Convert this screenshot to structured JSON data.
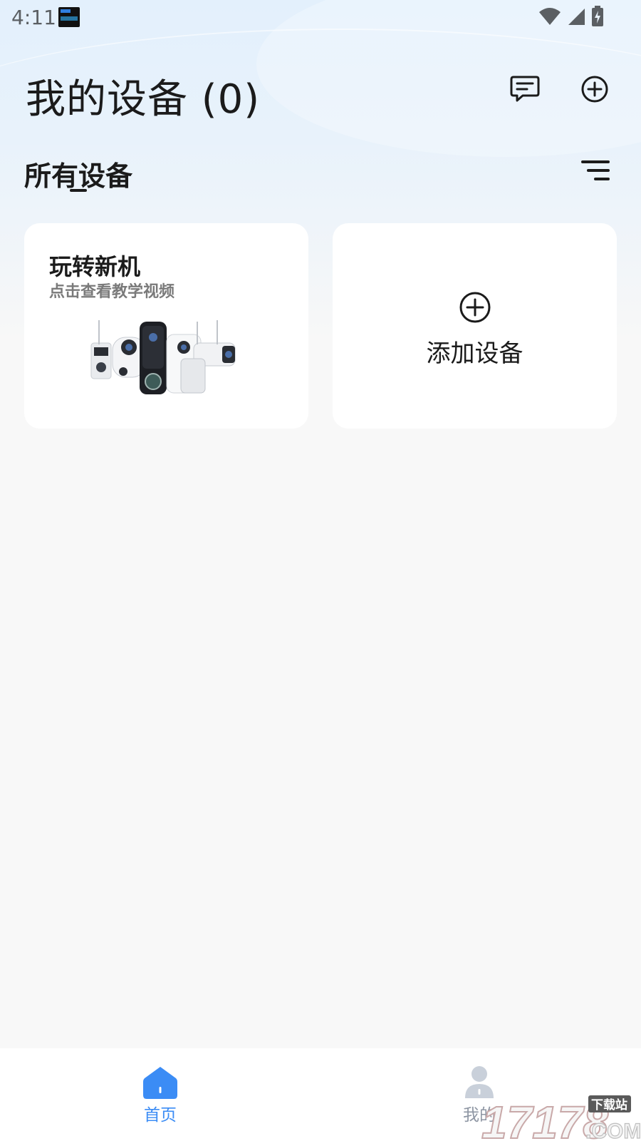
{
  "status_bar": {
    "time": "4:11",
    "icons": [
      "app-notification-icon",
      "wifi-icon",
      "signal-icon",
      "battery-charging-icon"
    ]
  },
  "header": {
    "title": "我的设备 (0)",
    "icons": [
      "message-icon",
      "add-circle-icon"
    ]
  },
  "section": {
    "title": "所有设备",
    "filter_icon": "filter-icon"
  },
  "cards": {
    "tutorial": {
      "title": "玩转新机",
      "subtitle": "点击查看教学视频"
    },
    "add_device": {
      "label": "添加设备",
      "icon": "add-circle-icon"
    }
  },
  "bottom_nav": {
    "items": [
      {
        "label": "首页",
        "icon": "home-icon",
        "active": true
      },
      {
        "label": "我的",
        "icon": "user-icon",
        "active": false
      }
    ]
  },
  "watermark": {
    "text": "17178",
    "tag": "下载站",
    "suffix": ".COM"
  },
  "colors": {
    "accent": "#3b8cf5",
    "inactive": "#8e96a3",
    "background": "#f8f8f8",
    "card": "#ffffff"
  }
}
